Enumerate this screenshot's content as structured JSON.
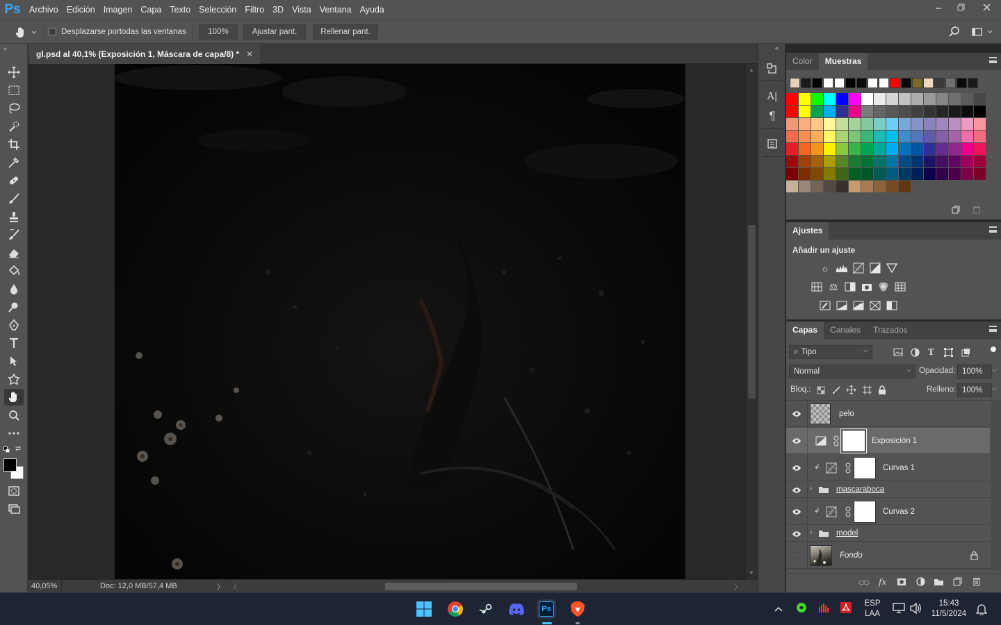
{
  "app": {
    "logo": "Ps",
    "menu": [
      "Archivo",
      "Edición",
      "Imagen",
      "Capa",
      "Texto",
      "Selección",
      "Filtro",
      "3D",
      "Vista",
      "Ventana",
      "Ayuda"
    ]
  },
  "options_bar": {
    "scroll_all_label": "Desplazarse portodas las ventanas",
    "zoom_value": "100%",
    "fit_screen": "Ajustar pant.",
    "fill_screen": "Rellenar pant."
  },
  "document": {
    "tab_title": "gl.psd al 40,1% (Exposición 1, Máscara de capa/8) *",
    "zoom_status": "40,05%",
    "doc_size": "Doc: 12,0 MB/57,4 MB"
  },
  "swatches_panel": {
    "tabs": [
      "Color",
      "Muestras"
    ],
    "active_tab": "Muestras",
    "recent": [
      "#e8d0b8",
      "#1a1a1a",
      "#000000",
      "#ffffff",
      "#ffffff",
      "#000000",
      "#0a0a0a",
      "#ffffff",
      "#ffffff",
      "#ff0000",
      "#0a0a0a",
      "#7a6a2a",
      "#f0d8b8",
      "#3a3a3a",
      "#707070",
      "#0a0a0a",
      "#1a1a1a"
    ],
    "grid": [
      [
        "#ff0000",
        "#ffff00",
        "#00ff00",
        "#00ffff",
        "#0000ff",
        "#ff00ff",
        "#ffffff",
        "#ebebeb",
        "#d6d6d6",
        "#c2c2c2",
        "#adadad",
        "#999999",
        "#858585",
        "#707070",
        "#5c5c5c",
        "#474747"
      ],
      [
        "#ff0000",
        "#ffff00",
        "#00a651",
        "#00aeef",
        "#2e3192",
        "#ec008c",
        "#7a7a7a",
        "#666666",
        "#595959",
        "#4d4d4d",
        "#404040",
        "#333333",
        "#262626",
        "#1a1a1a",
        "#0d0d0d",
        "#000000"
      ],
      [
        "#f7977a",
        "#f9ad81",
        "#fdc68a",
        "#fff79a",
        "#c4df9b",
        "#a3d39c",
        "#82ca9d",
        "#7bcdc8",
        "#6ecff6",
        "#7ea7d8",
        "#8493ca",
        "#8882be",
        "#a187be",
        "#bc8dbf",
        "#f49ac2",
        "#f6989d"
      ],
      [
        "#f26c4f",
        "#f68e55",
        "#fbaf5c",
        "#fff467",
        "#acd372",
        "#7cc576",
        "#3bb878",
        "#1abbb4",
        "#00bff3",
        "#438cca",
        "#5574b9",
        "#605ca8",
        "#855fa8",
        "#a763a8",
        "#f06ea9",
        "#f26d7d"
      ],
      [
        "#ed1c24",
        "#f26522",
        "#f7941d",
        "#fff200",
        "#8dc73f",
        "#39b54a",
        "#00a651",
        "#00a99d",
        "#00aeef",
        "#0072bc",
        "#0054a6",
        "#2e3192",
        "#662d91",
        "#92278f",
        "#ec008c",
        "#ed145b"
      ],
      [
        "#9e0b0f",
        "#a0410d",
        "#a36209",
        "#aba000",
        "#598527",
        "#1a7b30",
        "#007236",
        "#00746b",
        "#0076a3",
        "#004b80",
        "#003471",
        "#1b1464",
        "#440e62",
        "#630460",
        "#9e005d",
        "#9e0039"
      ],
      [
        "#790000",
        "#7b2e00",
        "#7d4900",
        "#827b00",
        "#406618",
        "#005e20",
        "#005826",
        "#005952",
        "#005b7f",
        "#003663",
        "#002157",
        "#0d004c",
        "#32004b",
        "#4b0049",
        "#7b0046",
        "#7a0026"
      ],
      [
        "#c7b299",
        "#998675",
        "#736357",
        "#534741",
        "#37302d",
        "#c69c6d",
        "#a67c52",
        "#8c6239",
        "#754c24",
        "#603913"
      ]
    ]
  },
  "adjustments_panel": {
    "tab": "Ajustes",
    "heading": "Añadir un ajuste"
  },
  "layers_panel": {
    "tabs": [
      "Capas",
      "Canales",
      "Trazados"
    ],
    "active_tab": "Capas",
    "filter": "Tipo",
    "blend_mode": "Normal",
    "opacity_label": "Opacidad:",
    "opacity": "100%",
    "lock_label": "Bloq.:",
    "fill_label": "Relleno:",
    "fill": "100%",
    "layers": [
      {
        "name": "pelo",
        "kind": "pixel",
        "visible": true,
        "selected": false
      },
      {
        "name": "Exposición 1",
        "kind": "adjustment",
        "visible": true,
        "selected": true
      },
      {
        "name": "Curvas 1",
        "kind": "adjustment-clipped",
        "visible": true,
        "selected": false
      },
      {
        "name": "mascaraboca",
        "kind": "group",
        "visible": true,
        "selected": false
      },
      {
        "name": "Curvas 2",
        "kind": "adjustment-clipped",
        "visible": true,
        "selected": false
      },
      {
        "name": "model",
        "kind": "group",
        "visible": true,
        "selected": false
      },
      {
        "name": "Fondo",
        "kind": "background",
        "visible": false,
        "selected": false,
        "locked": true
      }
    ]
  },
  "taskbar": {
    "lang": "ESP",
    "layout": "LAA",
    "time": "15:43",
    "date": "11/5/2024"
  },
  "colors": {
    "ps_blue": "#31a8ff",
    "panel_bg": "#535353",
    "canvas_bg": "#060606",
    "taskbar_bg": "#1e2433"
  }
}
